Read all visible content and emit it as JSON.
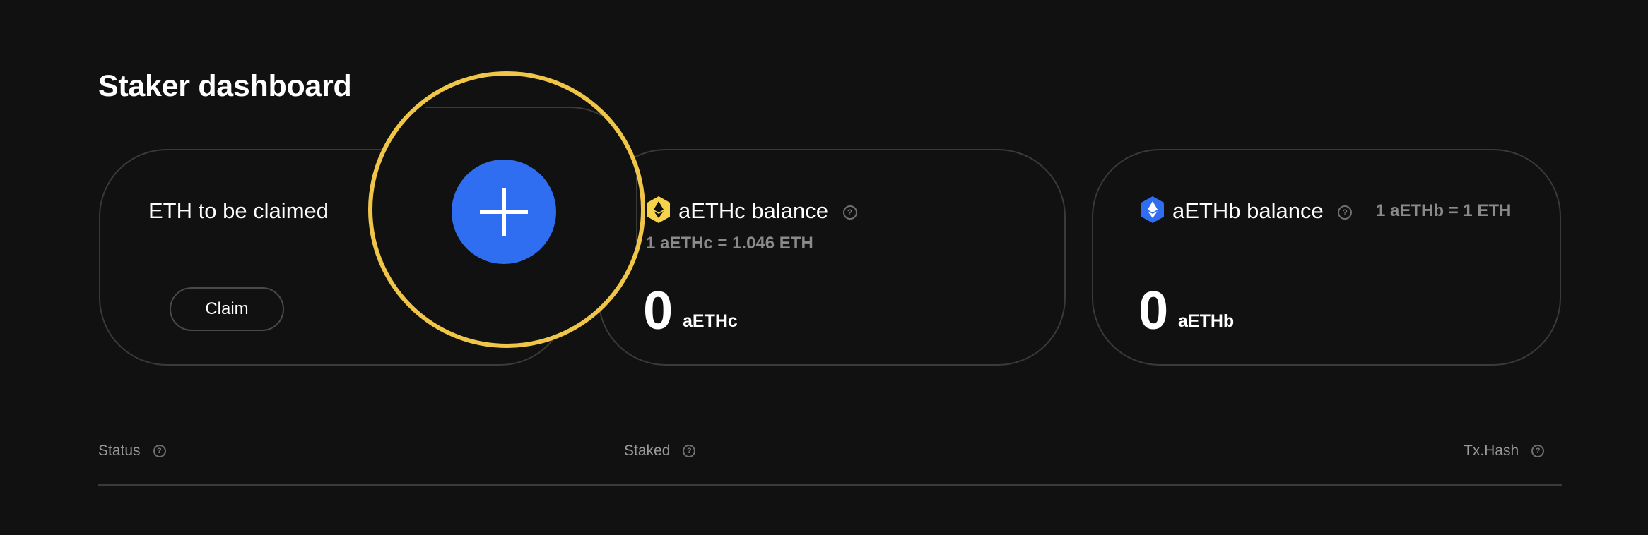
{
  "page": {
    "title": "Staker dashboard"
  },
  "claim_card": {
    "label": "ETH to be claimed",
    "button_label": "Claim"
  },
  "aethc_card": {
    "label": "aETHc balance",
    "rate": "1 aETHc = 1.046 ETH",
    "amount": "0",
    "unit": "aETHc",
    "icon": "ethereum-yellow-hex-icon",
    "icon_color": "#f5d34a"
  },
  "aethb_card": {
    "label": "aETHb balance",
    "rate": "1 aETHb = 1 ETH",
    "amount": "0",
    "unit": "aETHb",
    "icon": "ethereum-blue-hex-icon",
    "icon_color": "#2f6ef0"
  },
  "table": {
    "columns": [
      "Status",
      "Staked",
      "Tx.Hash"
    ]
  },
  "overlay": {
    "icon": "plus-icon",
    "button_color": "#2f6ef0",
    "ring_color": "#f0c649"
  },
  "help_glyph": "?"
}
